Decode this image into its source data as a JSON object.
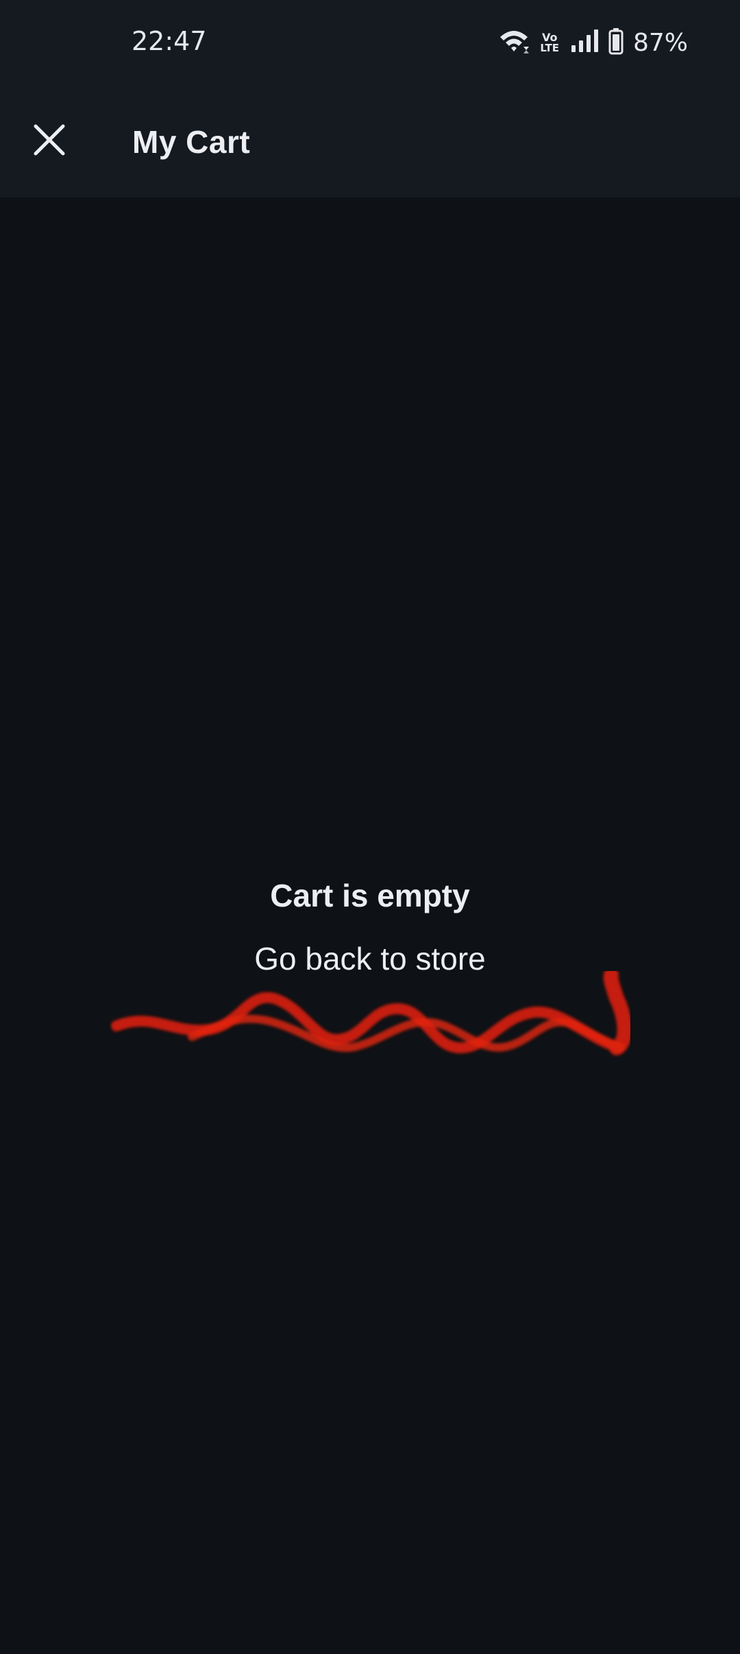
{
  "status_bar": {
    "time": "22:47",
    "battery_percent": "87%",
    "volte_top": "Vo",
    "volte_bottom": "LTE",
    "icons": [
      "wifi-icon",
      "volte-icon",
      "signal-icon",
      "battery-icon"
    ]
  },
  "app_bar": {
    "title": "My Cart",
    "close_icon": "close-icon"
  },
  "empty_state": {
    "title": "Cart is empty",
    "link_text": "Go back to store"
  },
  "colors": {
    "background": "#0e1115",
    "bar_background": "#151a21",
    "text": "#eceef2",
    "scribble": "#e01e0e"
  }
}
